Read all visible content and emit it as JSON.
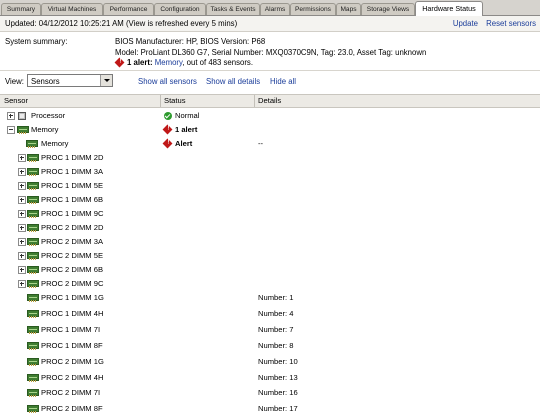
{
  "tabs": [
    "Summary",
    "Virtual Machines",
    "Performance",
    "Configuration",
    "Tasks & Events",
    "Alarms",
    "Permissions",
    "Maps",
    "Storage Views",
    "Hardware Status"
  ],
  "info": {
    "updated": "Updated: 04/12/2012  10:25:21 AM (View is refreshed every 5 mins)",
    "update_link": "Update",
    "reset_link": "Reset sensors"
  },
  "summary": {
    "label": "System summary:",
    "bios": "BIOS Manufacturer: HP, BIOS Version: P68",
    "model": "Model: ProLiant DL360 G7, Serial Number: MXQ0370C9N, Tag: 23.0,  Asset Tag: unknown",
    "alert_count": "1 alert:",
    "alert_link": "Memory",
    "alert_rest": ", out of 483 sensors."
  },
  "view": {
    "label": "View:",
    "selected": "Sensors",
    "show_all_sensors": "Show all sensors",
    "show_all_details": "Show all details",
    "hide_all": "Hide all"
  },
  "table": {
    "headers": [
      "Sensor",
      "Status",
      "Details"
    ],
    "rows": [
      {
        "name": "Processor",
        "status": "Normal",
        "status_icon": "ok",
        "details": ""
      },
      {
        "name": "Memory",
        "status": "1 alert",
        "status_icon": "alert",
        "details": ""
      },
      {
        "name": "Memory",
        "status": "Alert",
        "status_icon": "alert",
        "details": "--"
      },
      {
        "name": "PROC 1 DIMM 2D",
        "status": "",
        "details": ""
      },
      {
        "name": "PROC 1 DIMM 3A",
        "status": "",
        "details": ""
      },
      {
        "name": "PROC 1 DIMM 5E",
        "status": "",
        "details": ""
      },
      {
        "name": "PROC 1 DIMM 6B",
        "status": "",
        "details": ""
      },
      {
        "name": "PROC 1 DIMM 9C",
        "status": "",
        "details": ""
      },
      {
        "name": "PROC 2 DIMM 2D",
        "status": "",
        "details": ""
      },
      {
        "name": "PROC 2 DIMM 3A",
        "status": "",
        "details": ""
      },
      {
        "name": "PROC 2 DIMM 5E",
        "status": "",
        "details": ""
      },
      {
        "name": "PROC 2 DIMM 6B",
        "status": "",
        "details": ""
      },
      {
        "name": "PROC 2 DIMM 9C",
        "status": "",
        "details": ""
      },
      {
        "name": "PROC 1 DIMM 1G",
        "status": "",
        "details": "Number: 1"
      },
      {
        "name": "PROC 1 DIMM 4H",
        "status": "",
        "details": "Number: 4"
      },
      {
        "name": "PROC 1 DIMM 7I",
        "status": "",
        "details": "Number: 7"
      },
      {
        "name": "PROC 1 DIMM 8F",
        "status": "",
        "details": "Number: 8"
      },
      {
        "name": "PROC 2 DIMM 1G",
        "status": "",
        "details": "Number: 10"
      },
      {
        "name": "PROC 2 DIMM 4H",
        "status": "",
        "details": "Number: 13"
      },
      {
        "name": "PROC 2 DIMM 7I",
        "status": "",
        "details": "Number: 16"
      },
      {
        "name": "PROC 2 DIMM 8F",
        "status": "",
        "details": "Number: 17"
      }
    ]
  },
  "colors": {
    "link": "#1b3d9a",
    "alert": "#c01818",
    "ok": "#2e9b2e"
  }
}
